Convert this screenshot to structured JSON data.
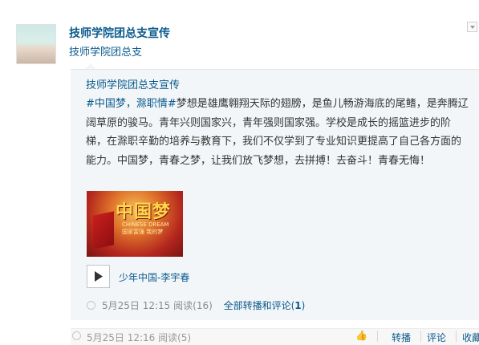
{
  "post": {
    "author": "技师学院团总支宣传",
    "author_sub": "技师学院团总支"
  },
  "quoted": {
    "author": "技师学院团总支宣传",
    "tags": "#中国梦，滁职情#",
    "text": "梦想是雄鹰翱翔天际的翅膀，是鱼儿畅游海底的尾鳍，是奔腾辽阔草原的骏马。青年兴则国家兴，青年强则国家强。学校是成长的摇篮进步的阶梯，在滁职辛勤的培养与教育下，我们不仅学到了专业知识更提高了自己各方面的能力。中国梦，青春之梦，让我们放飞梦想，去拼搏！去奋斗！青春无悔！",
    "image": {
      "title": "中国梦",
      "subtitle_en": "CHINESE DREAM",
      "subtitle_cn": "国家富强 我的梦"
    },
    "music": {
      "title": "少年中国-李宇春"
    },
    "meta": {
      "time": "5月25日 12:15",
      "reads": "阅读(16)",
      "repost_comment_label": "全部转播和评论(",
      "repost_comment_count": "1",
      "repost_comment_close": ")"
    }
  },
  "footer": {
    "time_reads": "5月25日 12:16 阅读(5)",
    "like_icon": "thumbs-up-icon",
    "actions": [
      "转播",
      "评论",
      "收藏"
    ]
  },
  "colors": {
    "link": "#0a5a8c",
    "quote_bg": "#f3f6f8"
  }
}
